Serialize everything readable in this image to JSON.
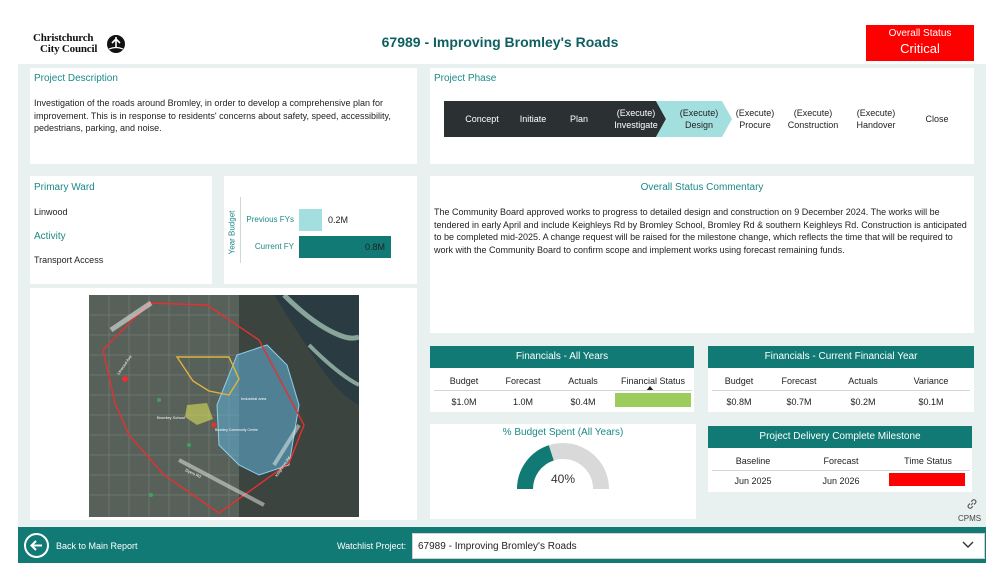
{
  "header": {
    "logo_line1": "Christchurch",
    "logo_line2": "City Council",
    "title": "67989 - Improving Bromley's Roads",
    "overall_status_label": "Overall Status",
    "overall_status_value": "Critical",
    "status_color": "#ff0000"
  },
  "description": {
    "title": "Project Description",
    "text": "Investigation of the roads around Bromley, in order to develop a comprehensive plan for improvement. This is in response to residents' concerns about safety, speed, accessibility, pedestrians, parking, and noise."
  },
  "phase": {
    "title": "Project Phase",
    "steps": [
      {
        "label": "Concept"
      },
      {
        "label": "Initiate"
      },
      {
        "label": "Plan"
      },
      {
        "label": "(Execute)\nInvestigate"
      },
      {
        "label": "(Execute)\nDesign"
      },
      {
        "label": "(Execute)\nProcure"
      },
      {
        "label": "(Execute)\nConstruction"
      },
      {
        "label": "(Execute)\nHandover"
      },
      {
        "label": "Close"
      }
    ],
    "completed_color": "#2b3033",
    "current_color": "#a4dfdf"
  },
  "ward": {
    "primary_ward_title": "Primary Ward",
    "primary_ward_value": "Linwood",
    "activity_title": "Activity",
    "activity_value": "Transport Access"
  },
  "year_budget": {
    "axis_label": "Year Budget",
    "bars": [
      {
        "label": "Previous FYs",
        "value": 0.2,
        "display": "0.2M",
        "color": "#a4dfdf"
      },
      {
        "label": "Current FY",
        "value": 0.8,
        "display": "0.8M",
        "color": "#117a74"
      }
    ]
  },
  "commentary": {
    "title": "Overall Status Commentary",
    "text": "The Community Board approved works to progress to detailed design and construction on 9 December 2024. The works will be tendered in early April and include Keighleys Rd by Bromley School, Bromley Rd & southern Keighleys Rd. Construction is anticipated to be completed mid-2025. A change request will be raised for the milestone change, which reflects the time that will be required to work with the Community Board to confirm scope and implement works using forecast remaining funds."
  },
  "fin_all": {
    "title": "Financials - All Years",
    "headers": [
      "Budget",
      "Forecast",
      "Actuals",
      "Financial Status"
    ],
    "values": [
      "$1.0M",
      "1.0M",
      "$0.4M"
    ],
    "status_color": "#9ccc5c"
  },
  "fin_current": {
    "title": "Financials - Current Financial Year",
    "headers": [
      "Budget",
      "Forecast",
      "Actuals",
      "Variance"
    ],
    "values": [
      "$0.8M",
      "$0.7M",
      "$0.2M",
      "$0.1M"
    ]
  },
  "budget_spent": {
    "title": "% Budget Spent (All Years)",
    "value": 40,
    "display": "40%",
    "fill_color": "#117a74",
    "track_color": "#d9d9d9"
  },
  "milestone": {
    "title": "Project Delivery Complete Milestone",
    "headers": [
      "Baseline",
      "Forecast",
      "Time Status"
    ],
    "values": [
      "Jun 2025",
      "Jun 2026"
    ],
    "status_color": "#ff0000"
  },
  "cpms": {
    "label": "CPMS"
  },
  "map": {
    "labels": [
      "Bromley School",
      "Industrial area",
      "Bromley Community Centre",
      "Linwood Ave",
      "Dyers Rd",
      "Keighleys Rd"
    ]
  },
  "footer": {
    "back_label": "Back to Main Report",
    "watchlist_label": "Watchlist Project:",
    "watchlist_value": "67989 - Improving Bromley's Roads"
  }
}
